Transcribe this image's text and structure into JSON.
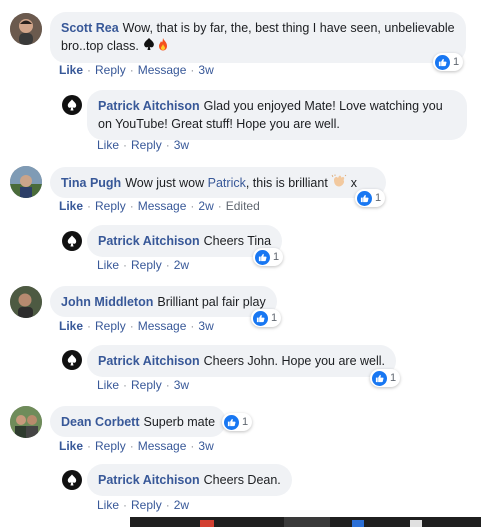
{
  "comments": [
    {
      "author": "Scott Rea",
      "text": "Wow, that is by far, the, best thing I have seen, unbelievable bro..top class.",
      "actions": {
        "like": "Like",
        "reply": "Reply",
        "message": "Message",
        "time": "3w"
      },
      "reactions": "1",
      "reply": {
        "author": "Patrick Aitchison",
        "text": "Glad you enjoyed Mate! Love watching you on YouTube! Great stuff! Hope you are well.",
        "actions": {
          "like": "Like",
          "reply": "Reply",
          "time": "3w"
        }
      }
    },
    {
      "author": "Tina Pugh",
      "text_before": "Wow just wow",
      "mention": "Patrick",
      "text_after": ", this is brilliant",
      "text_end": "x",
      "actions": {
        "like": "Like",
        "reply": "Reply",
        "message": "Message",
        "time": "2w",
        "edited": "Edited"
      },
      "reactions": "1",
      "reply": {
        "author": "Patrick Aitchison",
        "text": "Cheers Tina",
        "actions": {
          "like": "Like",
          "reply": "Reply",
          "time": "2w"
        },
        "reactions": "1"
      }
    },
    {
      "author": "John Middleton",
      "text": "Brilliant pal fair play",
      "actions": {
        "like": "Like",
        "reply": "Reply",
        "message": "Message",
        "time": "3w"
      },
      "reactions": "1",
      "reply": {
        "author": "Patrick Aitchison",
        "text": "Cheers John. Hope you are well.",
        "actions": {
          "like": "Like",
          "reply": "Reply",
          "time": "3w"
        },
        "reactions": "1"
      }
    },
    {
      "author": "Dean Corbett",
      "text": "Superb mate",
      "actions": {
        "like": "Like",
        "reply": "Reply",
        "message": "Message",
        "time": "3w"
      },
      "reactions": "1",
      "reply": {
        "author": "Patrick Aitchison",
        "text": "Cheers Dean.",
        "actions": {
          "like": "Like",
          "reply": "Reply",
          "time": "2w"
        }
      }
    }
  ],
  "colors": {
    "name": "#385898",
    "bubble": "#f0f2f5",
    "meta": "#606770",
    "like_blue": "#1877f2"
  },
  "icons": {
    "spade": "spade-emoji",
    "fire": "fire-emoji",
    "clap": "clap-emoji",
    "like": "like-thumb-icon"
  }
}
